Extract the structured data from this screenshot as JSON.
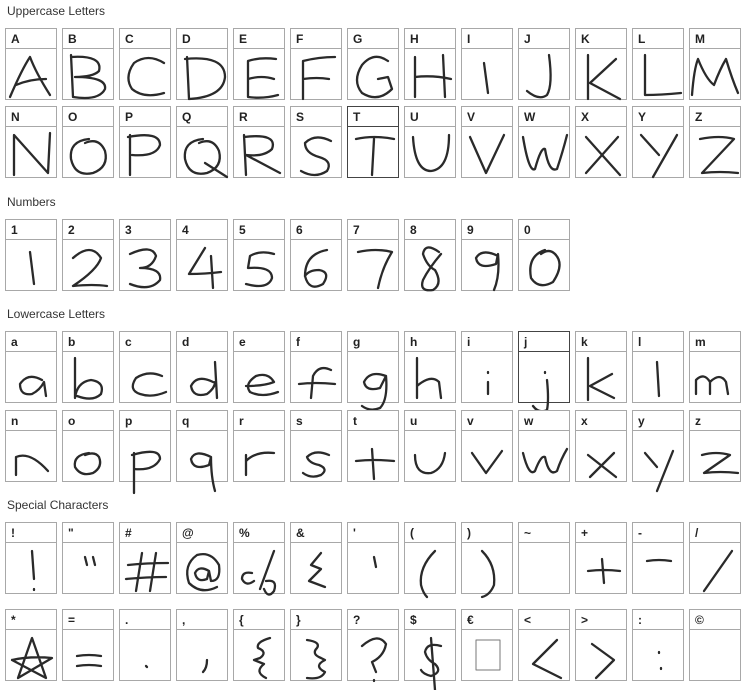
{
  "sections": [
    {
      "title": "Uppercase Letters",
      "rows": [
        [
          "A",
          "B",
          "C",
          "D",
          "E",
          "F",
          "G",
          "H",
          "I",
          "J",
          "K",
          "L",
          "M"
        ],
        [
          "N",
          "O",
          "P",
          "Q",
          "R",
          "S",
          "T",
          "U",
          "V",
          "W",
          "X",
          "Y",
          "Z"
        ]
      ]
    },
    {
      "title": "Numbers",
      "rows": [
        [
          "1",
          "2",
          "3",
          "4",
          "5",
          "6",
          "7",
          "8",
          "9",
          "0"
        ]
      ]
    },
    {
      "title": "Lowercase Letters",
      "rows": [
        [
          "a",
          "b",
          "c",
          "d",
          "e",
          "f",
          "g",
          "h",
          "i",
          "j",
          "k",
          "l",
          "m"
        ],
        [
          "n",
          "o",
          "p",
          "q",
          "r",
          "s",
          "t",
          "u",
          "v",
          "w",
          "x",
          "y",
          "z"
        ]
      ]
    },
    {
      "title": "Special Characters",
      "rows": [
        [
          "!",
          "\"",
          "#",
          "@",
          "%",
          "&",
          "'",
          "(",
          ")",
          "~",
          "+",
          "-",
          "/"
        ],
        [
          "*",
          "=",
          ".",
          ",",
          "{",
          "}",
          "?",
          "$",
          "€",
          "<",
          ">",
          ":",
          "©"
        ]
      ]
    }
  ],
  "highlighted": [
    "T",
    "j"
  ]
}
